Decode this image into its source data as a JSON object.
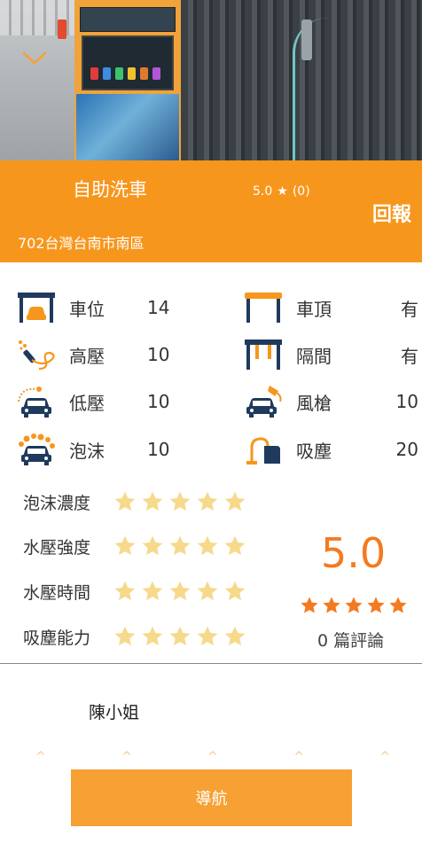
{
  "station": {
    "name": "自助洗車",
    "rating_value": "5.0",
    "rating_star": "★",
    "rating_count": "(0)",
    "report_label": "回報",
    "address": "702台灣台南市南區"
  },
  "facilities": [
    {
      "label": "車位",
      "value": "14",
      "icon": "car-bay-icon"
    },
    {
      "label": "車頂",
      "value": "有",
      "icon": "roof-canopy-icon"
    },
    {
      "label": "高壓",
      "value": "10",
      "icon": "high-pressure-gun-icon"
    },
    {
      "label": "隔間",
      "value": "有",
      "icon": "partition-icon"
    },
    {
      "label": "低壓",
      "value": "10",
      "icon": "low-pressure-car-icon"
    },
    {
      "label": "風槍",
      "value": "10",
      "icon": "air-gun-car-icon"
    },
    {
      "label": "泡沫",
      "value": "10",
      "icon": "foam-car-icon"
    },
    {
      "label": "吸塵",
      "value": "20",
      "icon": "vacuum-icon"
    }
  ],
  "ratings": [
    {
      "label": "泡沫濃度",
      "stars": 5
    },
    {
      "label": "水壓強度",
      "stars": 5
    },
    {
      "label": "水壓時間",
      "stars": 5
    },
    {
      "label": "吸塵能力",
      "stars": 5
    }
  ],
  "summary": {
    "score": "5.0",
    "stars": 5,
    "review_count": "0 篇評論"
  },
  "review": {
    "reviewer": "陳小姐",
    "carets": [
      "^",
      "^",
      "^",
      "^",
      "^"
    ]
  },
  "navigation": {
    "button_label": "導航"
  },
  "colors": {
    "brand_orange": "#f7961d",
    "navy": "#1f3a5c",
    "star_light": "#f6d98a",
    "star_orange": "#f47a1f"
  }
}
